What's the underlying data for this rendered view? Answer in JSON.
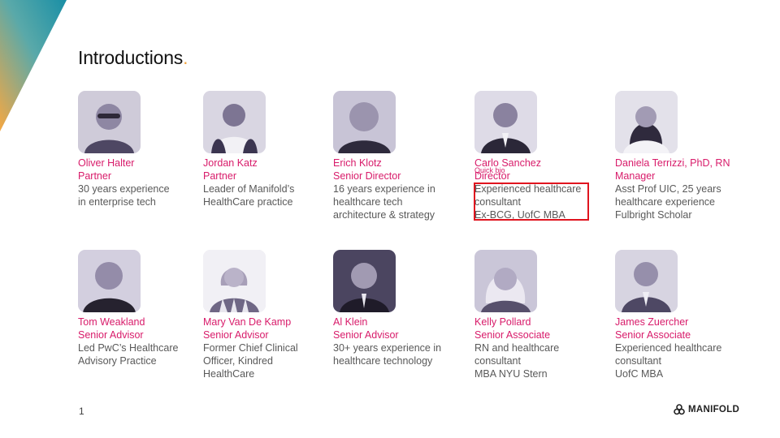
{
  "slide": {
    "title": "Introductions",
    "title_dot": ".",
    "page_number": "1",
    "logo_text": "MANIFOLD",
    "accent_color": "#d81b6a",
    "dot_color": "#f2a541",
    "highlight_color": "#e0141e"
  },
  "team": [
    {
      "name": "Oliver Halter",
      "role": "Partner",
      "desc": [
        "30 years experience",
        "in enterprise tech"
      ]
    },
    {
      "name": "Jordan Katz",
      "role": "Partner",
      "desc": [
        "Leader of Manifold’s",
        "HealthCare practice"
      ]
    },
    {
      "name": "Erich Klotz",
      "role": "Senior Director",
      "desc": [
        "16 years experience in",
        "healthcare tech",
        "architecture & strategy"
      ]
    },
    {
      "name": "Carlo Sanchez",
      "role": "Director",
      "desc": [
        "Experienced healthcare",
        "consultant",
        "Ex-BCG, UofC MBA"
      ]
    },
    {
      "name": "Daniela Terrizzi, PhD, RN",
      "role": "Manager",
      "desc": [
        "Asst Prof UIC, 25 years",
        "healthcare experience",
        "Fulbright Scholar"
      ]
    },
    {
      "name": "Tom Weakland",
      "role": "Senior Advisor",
      "desc": [
        "Led PwC’s Healthcare",
        "Advisory Practice"
      ]
    },
    {
      "name": "Mary Van De Kamp",
      "role": "Senior Advisor",
      "desc": [
        "Former Chief Clinical",
        "Officer, Kindred",
        "HealthCare"
      ]
    },
    {
      "name": "Al Klein",
      "role": "Senior Advisor",
      "desc": [
        "30+ years experience in",
        "healthcare technology"
      ]
    },
    {
      "name": "Kelly Pollard",
      "role": "Senior Associate",
      "desc": [
        "RN and healthcare",
        "consultant",
        "MBA NYU Stern"
      ]
    },
    {
      "name": "James Zuercher",
      "role": "Senior Associate",
      "desc": [
        "Experienced healthcare",
        "consultant",
        "UofC MBA"
      ]
    }
  ],
  "annotation": {
    "label": "Quick bio"
  }
}
